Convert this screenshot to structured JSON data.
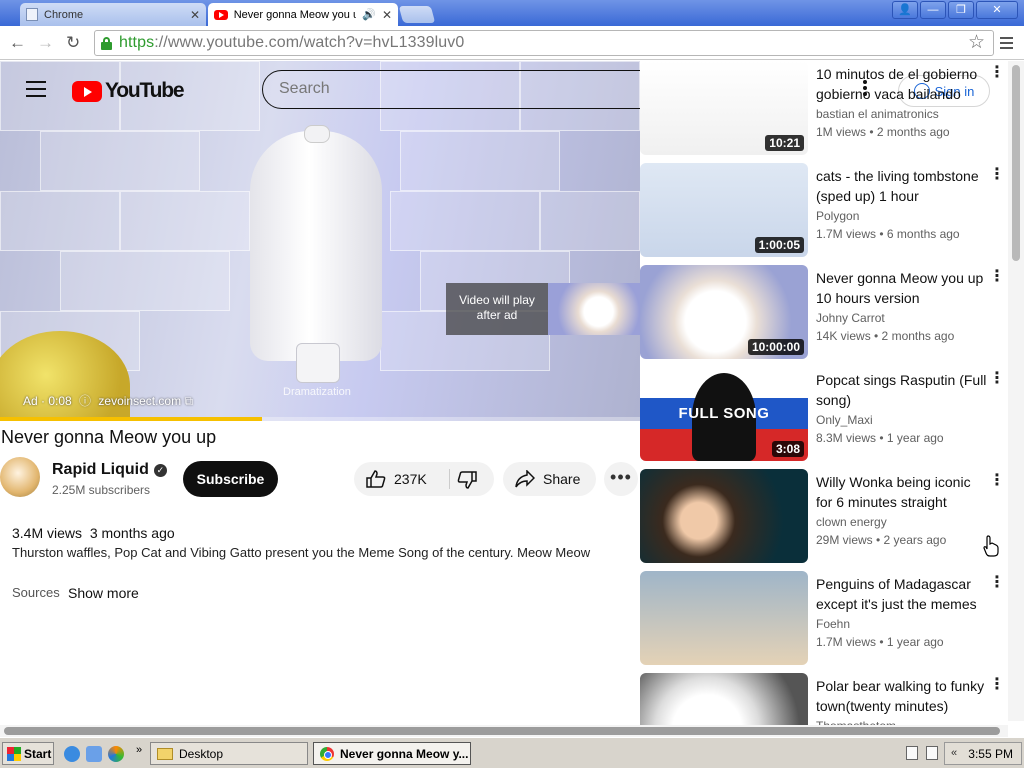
{
  "browser": {
    "tabs": [
      {
        "label": "Chrome",
        "active": false
      },
      {
        "label": "Never gonna Meow you u",
        "active": true
      }
    ],
    "url_scheme": "https",
    "url_rest": "://www.youtube.com/watch?v=hvL1339luv0"
  },
  "masthead": {
    "logo_text": "YouTube",
    "search_placeholder": "Search",
    "signin_label": "Sign in"
  },
  "player": {
    "ad_label": "Ad · 0:08",
    "ad_domain": "zevoinsect.com",
    "dramatization": "Dramatization",
    "ad_preview_text": "Video will play after ad",
    "ad_progress": 0.41
  },
  "video": {
    "title": "Never gonna Meow you up",
    "channel": "Rapid Liquid",
    "subscribers": "2.25M subscribers",
    "subscribe_label": "Subscribe",
    "likes": "237K",
    "share_label": "Share",
    "views": "3.4M views",
    "age": "3 months ago",
    "description": "Thurston waffles, Pop Cat and Vibing Gatto present you the Meme Song of the century. Meow Meow",
    "sources": "Sources",
    "show_more": "Show more"
  },
  "recommendations": [
    {
      "title": "10 minutos de el gobierno gobierno vaca bailando",
      "channel": "bastian el animatronics",
      "views": "1M views",
      "age": "2 months ago",
      "duration": "10:21",
      "thumb": "cow"
    },
    {
      "title": "cats - the living tombstone (sped up) 1 hour",
      "channel": "Polygon",
      "views": "1.7M views",
      "age": "6 months ago",
      "duration": "1:00:05",
      "thumb": "cat-dance"
    },
    {
      "title": "Never gonna Meow you up 10 hours version",
      "channel": "Johny Carrot",
      "views": "14K views",
      "age": "2 months ago",
      "duration": "10:00:00",
      "thumb": "popcat"
    },
    {
      "title": "Popcat sings Rasputin (Full song)",
      "channel": "Only_Maxi",
      "views": "8.3M views",
      "age": "1 year ago",
      "duration": "3:08",
      "thumb": "full-song",
      "thumb_text": "FULL SONG"
    },
    {
      "title": "Willy Wonka being iconic for 6 minutes straight",
      "channel": "clown energy",
      "views": "29M views",
      "age": "2 years ago",
      "duration": "",
      "thumb": "wonka"
    },
    {
      "title": "Penguins of Madagascar except it's just the memes",
      "channel": "Foehn",
      "views": "1.7M views",
      "age": "1 year ago",
      "duration": "",
      "thumb": "penguins"
    },
    {
      "title": "Polar bear walking to funky town(twenty minutes)",
      "channel": "Thomasthetom",
      "views": "",
      "age": "",
      "duration": "",
      "thumb": "bear"
    }
  ],
  "taskbar": {
    "start_label": "Start",
    "desktop_label": "Desktop",
    "active_window": "Never gonna Meow y...",
    "clock": "3:55 PM"
  }
}
